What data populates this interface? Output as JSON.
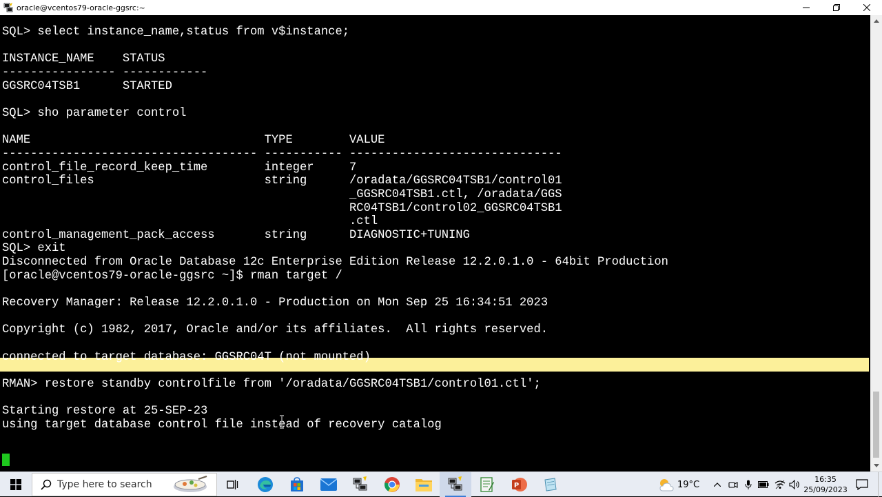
{
  "window": {
    "title": "oracle@vcentos79-oracle-ggsrc:~"
  },
  "terminal": {
    "lines": [
      "",
      "SQL> select instance_name,status from v$instance;",
      "",
      "INSTANCE_NAME    STATUS",
      "---------------- ------------",
      "GGSRC04TSB1      STARTED",
      "",
      "SQL> sho parameter control",
      "",
      "NAME                                 TYPE        VALUE",
      "------------------------------------ ----------- ------------------------------",
      "control_file_record_keep_time        integer     7",
      "control_files                        string      /oradata/GGSRC04TSB1/control01",
      "                                                 _GGSRC04TSB1.ctl, /oradata/GGS",
      "                                                 RC04TSB1/control02_GGSRC04TSB1",
      "                                                 .ctl",
      "control_management_pack_access       string      DIAGNOSTIC+TUNING",
      "SQL> exit",
      "Disconnected from Oracle Database 12c Enterprise Edition Release 12.2.0.1.0 - 64bit Production",
      "[oracle@vcentos79-oracle-ggsrc ~]$ rman target /",
      "",
      "Recovery Manager: Release 12.2.0.1.0 - Production on Mon Sep 25 16:34:51 2023",
      "",
      "Copyright (c) 1982, 2017, Oracle and/or its affiliates.  All rights reserved.",
      "",
      "connected to target database: GGSRC04T (not mounted)",
      "",
      "RMAN> restore standby controlfile from '/oradata/GGSRC04TSB1/control01.ctl';",
      "",
      "Starting restore at 25-SEP-23",
      "using target database control file instead of recovery catalog"
    ]
  },
  "taskbar": {
    "search_placeholder": "Type here to search",
    "weather": "19°C",
    "time": "16:35",
    "date": "25/09/2023",
    "apps": [
      "start-icon",
      "search-icon",
      "task-view-icon",
      "edge-icon",
      "store-icon",
      "mail-icon",
      "network-tool-icon",
      "chrome-icon",
      "file-explorer-icon",
      "putty-icon",
      "notepad-icon",
      "powerpoint-icon",
      "notes-icon"
    ]
  },
  "colors": {
    "terminal_bg": "#000000",
    "terminal_fg": "#ffffff",
    "highlight": "#fcf09a",
    "cursor": "#1ec81e"
  }
}
